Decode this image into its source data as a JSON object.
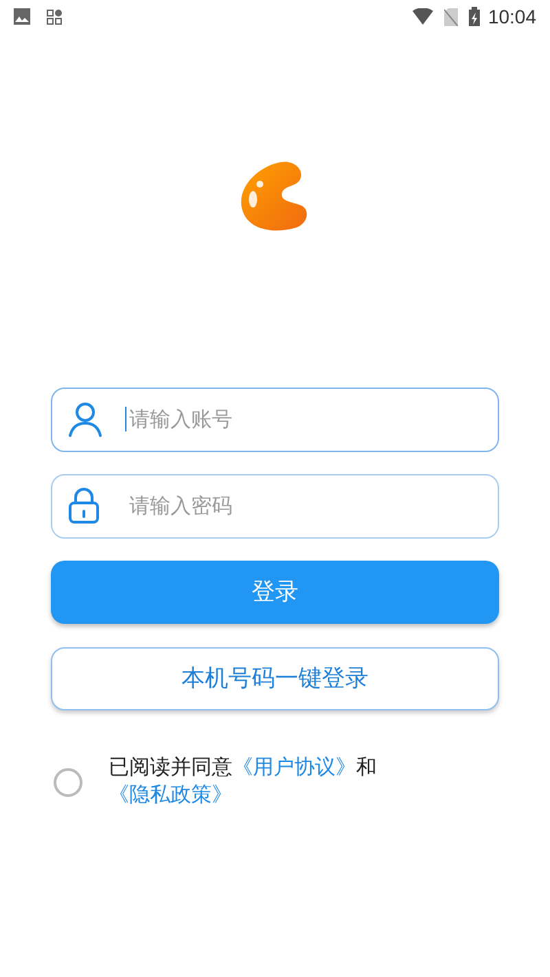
{
  "status_bar": {
    "time": "10:04"
  },
  "fields": [
    {
      "kind": "account",
      "placeholder": "请输入账号",
      "focused": true
    },
    {
      "kind": "password",
      "placeholder": "请输入密码",
      "focused": false
    }
  ],
  "buttons": [
    {
      "kind": "primary",
      "label": "登录"
    },
    {
      "kind": "outline",
      "label": "本机号码一键登录"
    }
  ],
  "agreement": {
    "checked": false,
    "parts": [
      {
        "kind": "text",
        "text": "已阅读并同意"
      },
      {
        "kind": "link",
        "text": "《用户协议》"
      },
      {
        "kind": "text",
        "text": "和"
      },
      {
        "kind": "link",
        "text": "《隐私政策》"
      }
    ]
  }
}
